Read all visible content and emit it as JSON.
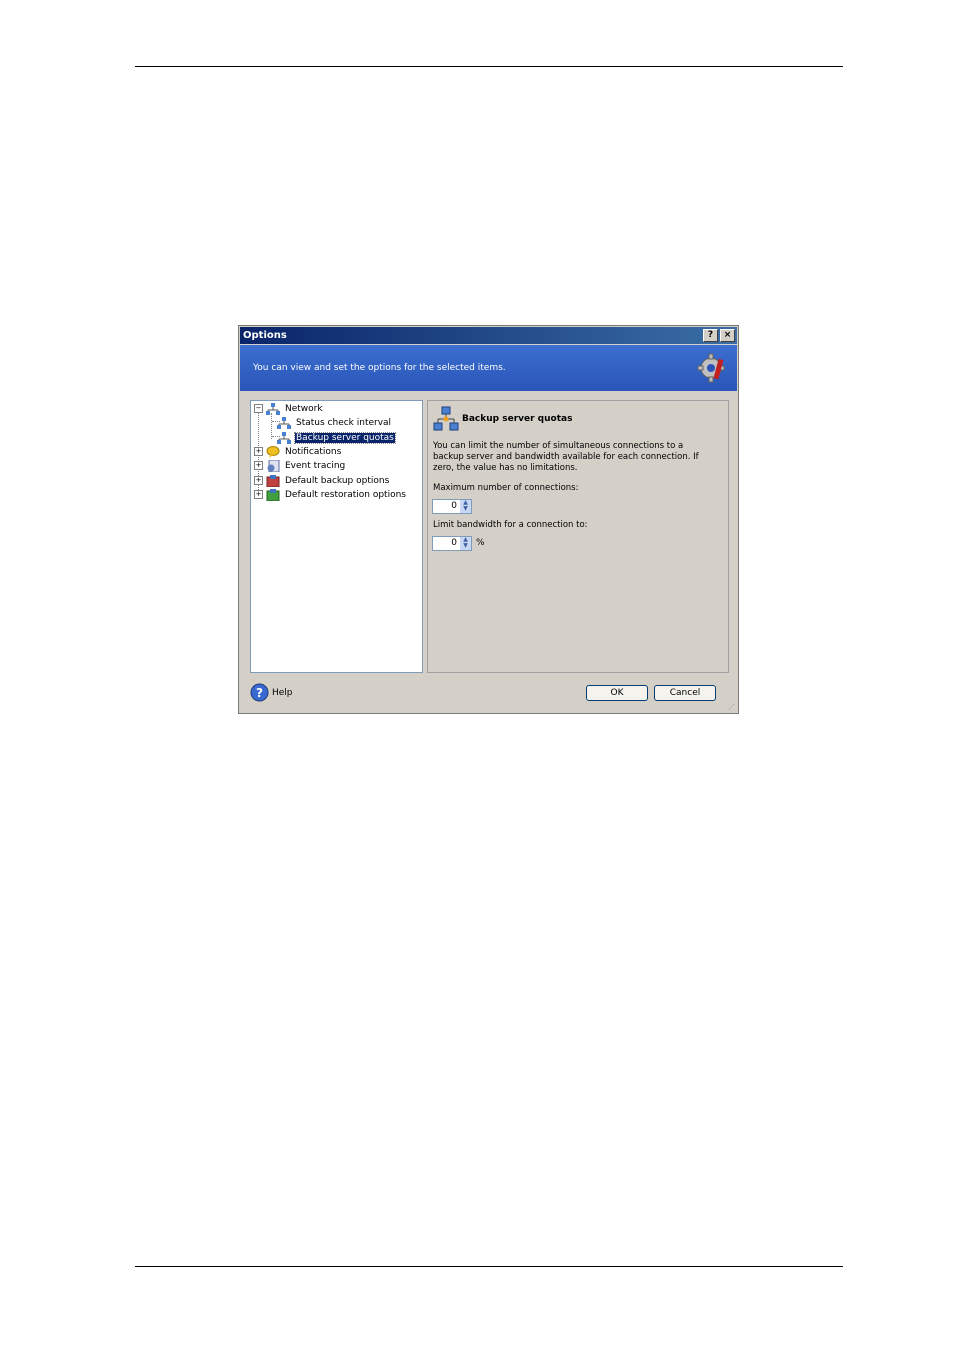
{
  "dialog": {
    "title": "Options",
    "title_buttons": {
      "help": "?",
      "close": "×"
    },
    "banner_text": "You can view and set the options for the selected items.",
    "banner_icon": "gear-wrench-icon",
    "tree": {
      "items": [
        {
          "label": "Network",
          "expander": "−",
          "icon": "network-icon"
        },
        {
          "label": "Status check interval",
          "icon": "network-icon"
        },
        {
          "label": "Backup server quotas",
          "icon": "network-icon",
          "selected": true
        },
        {
          "label": "Notifications",
          "expander": "+",
          "icon": "notification-icon"
        },
        {
          "label": "Event tracing",
          "expander": "+",
          "icon": "event-tracing-icon"
        },
        {
          "label": "Default backup options",
          "expander": "+",
          "icon": "backup-options-icon"
        },
        {
          "label": "Default restoration options",
          "expander": "+",
          "icon": "restoration-options-icon"
        }
      ]
    },
    "panel": {
      "title": "Backup server quotas",
      "description": "You can limit the number of simultaneous connections to a backup server and bandwidth available for each connection. If zero, the value has no limitations.",
      "max_connections_label": "Maximum number of connections:",
      "max_connections_value": "0",
      "bandwidth_label": "Limit bandwidth for a connection to:",
      "bandwidth_value": "0",
      "bandwidth_unit": "%"
    },
    "footer": {
      "help_label": "Help",
      "ok_label": "OK",
      "cancel_label": "Cancel"
    }
  }
}
